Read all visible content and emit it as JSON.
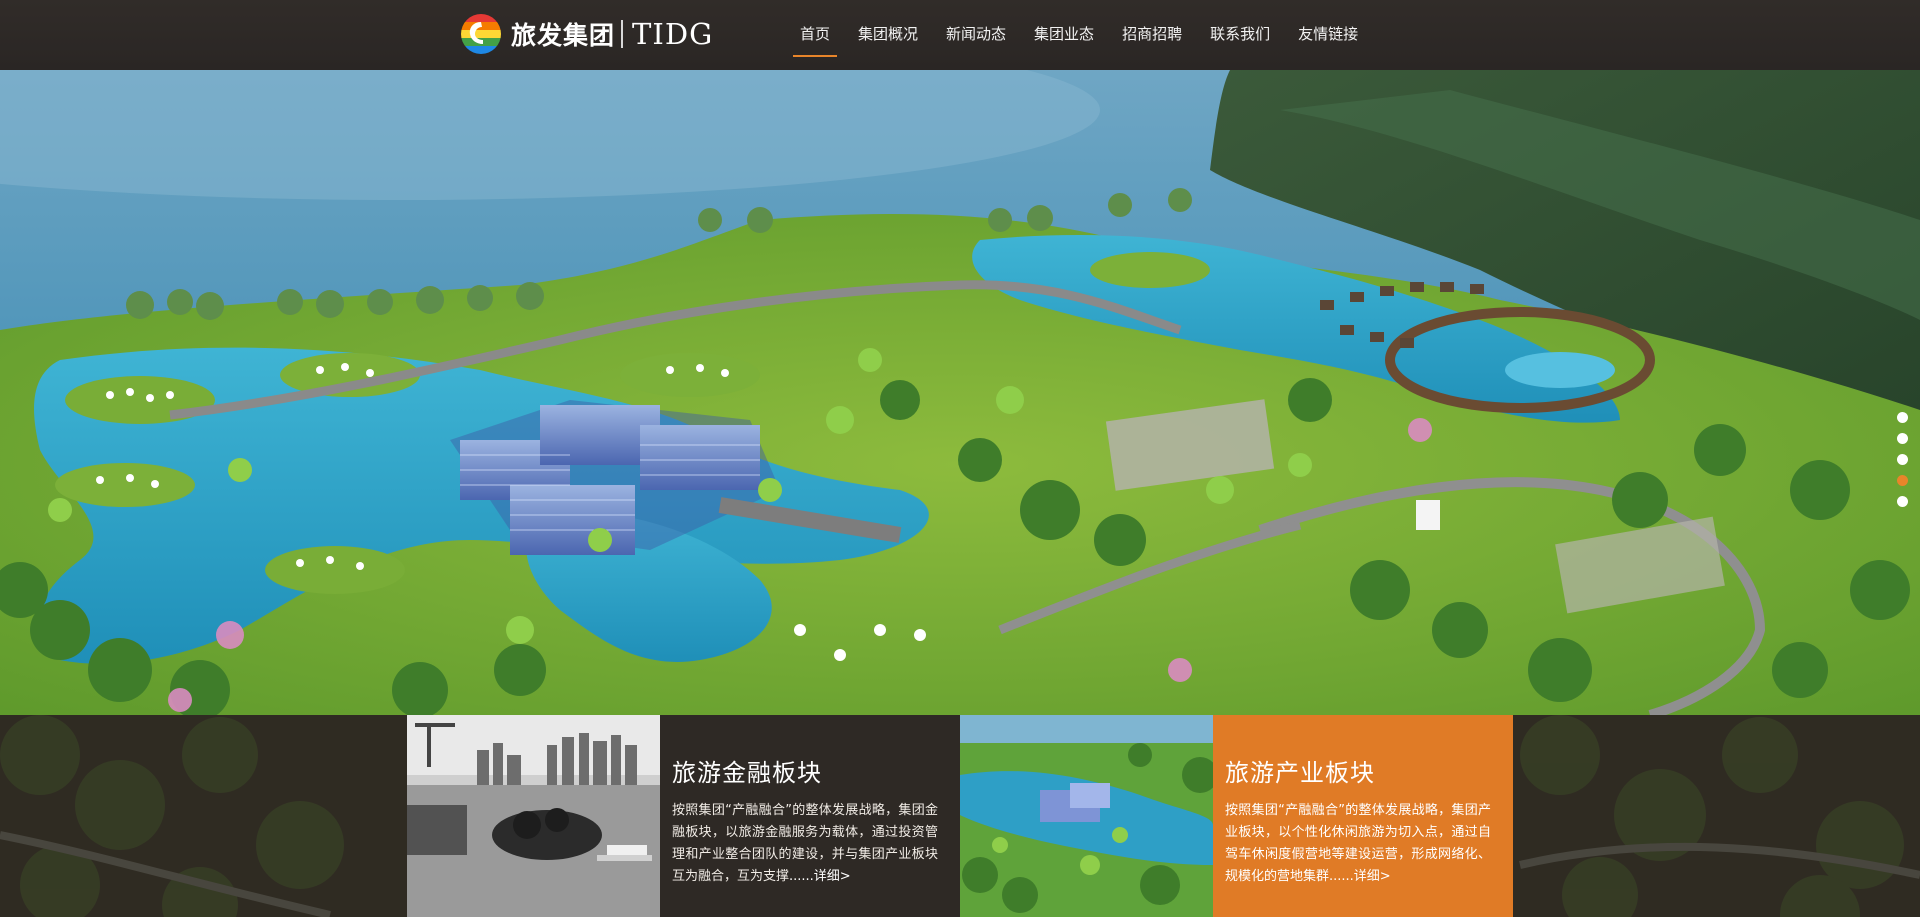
{
  "brand": {
    "name_cn": "旅发集团",
    "name_en": "TIDG",
    "colors": {
      "accent": "#e8852a",
      "header_bg": "#2c2826"
    }
  },
  "nav": {
    "items": [
      {
        "label": "首页",
        "active": true
      },
      {
        "label": "集团概况"
      },
      {
        "label": "新闻动态"
      },
      {
        "label": "集团业态"
      },
      {
        "label": "招商招聘"
      },
      {
        "label": "联系我们"
      },
      {
        "label": "友情链接"
      }
    ]
  },
  "hero": {
    "slide_count": 5,
    "active_slide": 4,
    "image": "aerial-resort-rendering"
  },
  "sections": {
    "finance": {
      "title": "旅游金融板块",
      "desc": "按照集团“产融融合”的整体发展战略，集团金融板块，以旅游金融服务为载体，通过投资管理和产业整合团队的建设，并与集团产业板块互为融合，互为支撑",
      "more": "......详细>",
      "bg_color": "#2e2925",
      "image": "black-white-city-waterfront"
    },
    "industry": {
      "title": "旅游产业板块",
      "desc": "按照集团“产融融合”的整体发展战略，集团产业板块，以个性化休闲旅游为切入点，通过自驾车休闲度假营地等建设运营，形成网络化、规模化的营地集群",
      "more": "......详细>",
      "bg_color": "#e07b26",
      "image": "resort-aerial-thumbnail"
    }
  }
}
